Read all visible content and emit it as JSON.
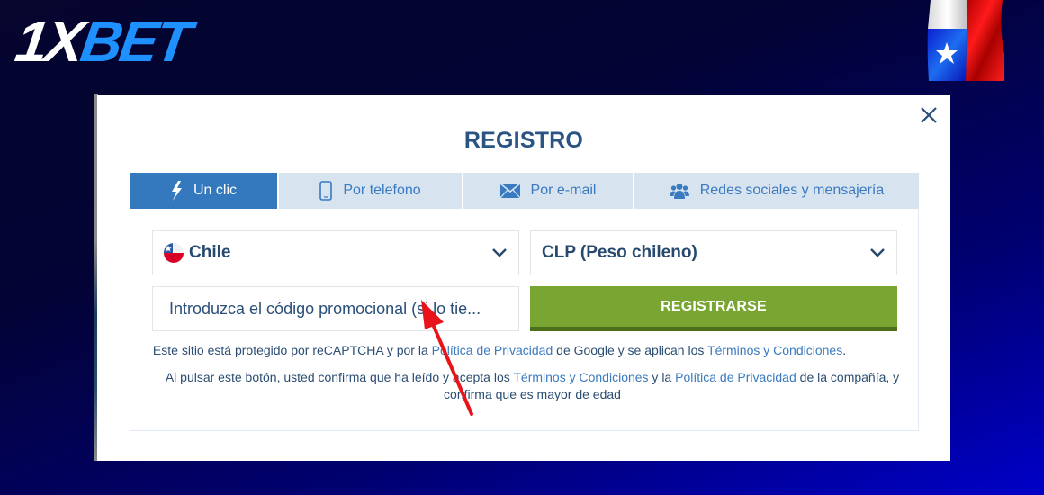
{
  "brand": {
    "logo_part1": "1X",
    "logo_part2": "BET",
    "colors": {
      "logo_white": "#ffffff",
      "logo_blue": "#1e90ff"
    }
  },
  "corner_flag": {
    "icon": "chile-flag-icon"
  },
  "modal": {
    "title": "REGISTRO",
    "close_icon": "close-icon",
    "tabs": [
      {
        "label": "Un clic",
        "icon": "lightning-icon",
        "active": true
      },
      {
        "label": "Por telefono",
        "icon": "phone-icon",
        "active": false
      },
      {
        "label": "Por e-mail",
        "icon": "envelope-icon",
        "active": false
      },
      {
        "label": "Redes sociales y mensajería",
        "icon": "users-icon",
        "active": false
      }
    ],
    "country_select": {
      "value": "Chile",
      "icon": "chile-flag-icon"
    },
    "currency_select": {
      "value": "CLP (Peso chileno)"
    },
    "promo_input": {
      "placeholder": "Introduzca el código promocional (si lo tie..."
    },
    "register_button": "REGISTRARSE",
    "legal_1": {
      "prefix": "Este sitio está protegido por reCAPTCHA y por la ",
      "link1": "Política de Privacidad",
      "middle": " de Google y se aplican los ",
      "link2": "Términos y Condiciones",
      "suffix": "."
    },
    "legal_2": {
      "prefix": "Al pulsar este botón, usted confirma que ha leído y acepta los ",
      "link1": "Términos y Condiciones",
      "middle": " y la ",
      "link2": "Política de Privacidad",
      "suffix": " de la compañía, y confirma que es mayor de edad"
    },
    "colors": {
      "title": "#2a5482",
      "tab_active_bg": "#3479be",
      "tab_inactive_bg": "#d7e4f0",
      "register_button_bg": "#79a532",
      "annotation_arrow": "#e8141a"
    }
  },
  "annotation": {
    "type": "arrow",
    "points_to": "promo-code-input"
  }
}
